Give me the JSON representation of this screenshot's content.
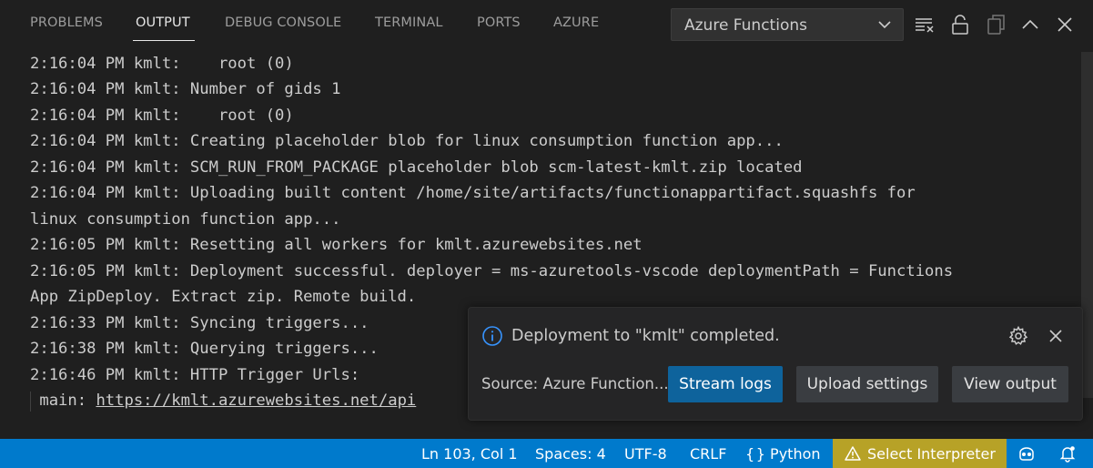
{
  "tabs": [
    {
      "label": "PROBLEMS",
      "active": false
    },
    {
      "label": "OUTPUT",
      "active": true
    },
    {
      "label": "DEBUG CONSOLE",
      "active": false
    },
    {
      "label": "TERMINAL",
      "active": false
    },
    {
      "label": "PORTS",
      "active": false
    },
    {
      "label": "AZURE",
      "active": false
    }
  ],
  "output_channel": {
    "selected": "Azure Functions"
  },
  "toolbar": {
    "icons": [
      "clear-output-icon",
      "lock-scroll-icon",
      "copy-icon",
      "maximize-panel-icon",
      "close-panel-icon"
    ]
  },
  "log": {
    "lines": [
      "2:16:04 PM kmlt:    root (0)",
      "2:16:04 PM kmlt: Number of gids 1",
      "2:16:04 PM kmlt:    root (0)",
      "2:16:04 PM kmlt: Creating placeholder blob for linux consumption function app...",
      "2:16:04 PM kmlt: SCM_RUN_FROM_PACKAGE placeholder blob scm-latest-kmlt.zip located",
      "2:16:04 PM kmlt: Uploading built content /home/site/artifacts/functionappartifact.squashfs for",
      "linux consumption function app...",
      "2:16:05 PM kmlt: Resetting all workers for kmlt.azurewebsites.net",
      "2:16:05 PM kmlt: Deployment successful. deployer = ms-azuretools-vscode deploymentPath = Functions",
      "App ZipDeploy. Extract zip. Remote build.",
      "2:16:33 PM kmlt: Syncing triggers...",
      "2:16:38 PM kmlt: Querying triggers...",
      "2:16:46 PM kmlt: HTTP Trigger Urls:"
    ],
    "link_prefix": " main: ",
    "link_url": "https://kmlt.azurewebsites.net/api"
  },
  "toast": {
    "message": "Deployment to \"kmlt\" completed.",
    "source": "Source: Azure Function...",
    "buttons": {
      "stream_logs": "Stream logs",
      "upload_settings": "Upload settings",
      "view_output": "View output"
    },
    "icons": {
      "info": "info-icon",
      "settings": "gear-icon",
      "close": "close-icon"
    }
  },
  "statusbar": {
    "position": "Ln 103, Col 1",
    "spaces": "Spaces: 4",
    "encoding": "UTF-8",
    "eol": "CRLF",
    "language": "Python",
    "interpreter": "Select Interpreter",
    "icons": [
      "braces-icon",
      "warning-icon",
      "copilot-icon",
      "notifications-icon"
    ]
  },
  "colors": {
    "background": "#1f1f1f",
    "statusbar": "#007acc",
    "warning_bg": "#b7a227",
    "primary_button": "#0e639c",
    "secondary_button": "#3a3d41",
    "info_icon": "#3794ff"
  }
}
